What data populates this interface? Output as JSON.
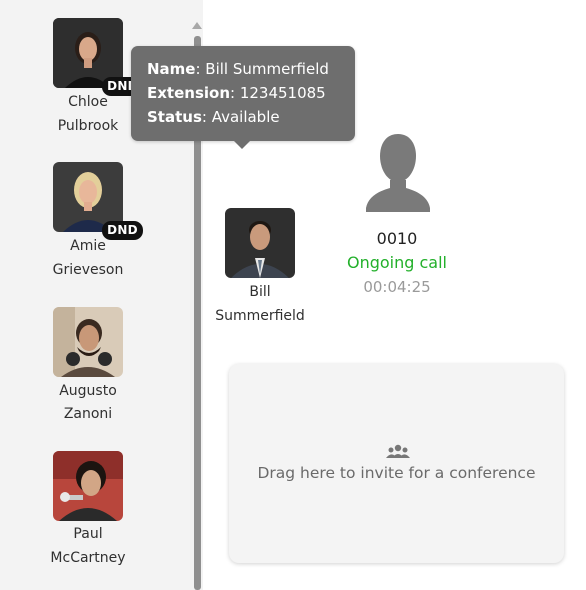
{
  "contacts": [
    {
      "first": "Chloe",
      "last": "Pulbrook",
      "badge": "DND"
    },
    {
      "first": "Amie",
      "last": "Grieveson",
      "badge": "DND"
    },
    {
      "first": "Augusto",
      "last": "Zanoni",
      "badge": ""
    },
    {
      "first": "Paul",
      "last": "McCartney",
      "badge": ""
    }
  ],
  "tooltip": {
    "name_label": "Name",
    "name_value": ": Bill Summerfield",
    "extension_label": "Extension",
    "extension_value": ": 123451085",
    "status_label": "Status",
    "status_value": ": Available"
  },
  "caller": {
    "first": "Bill",
    "last": "Summerfield"
  },
  "call": {
    "number": "0010",
    "status": "Ongoing call",
    "timer": "00:04:25"
  },
  "conference": {
    "text": "Drag here to invite for a conference",
    "icon": "group-icon"
  },
  "colors": {
    "ongoing": "#23b02b",
    "tooltip_bg": "#6e6e6e",
    "badge_bg": "#111111"
  }
}
